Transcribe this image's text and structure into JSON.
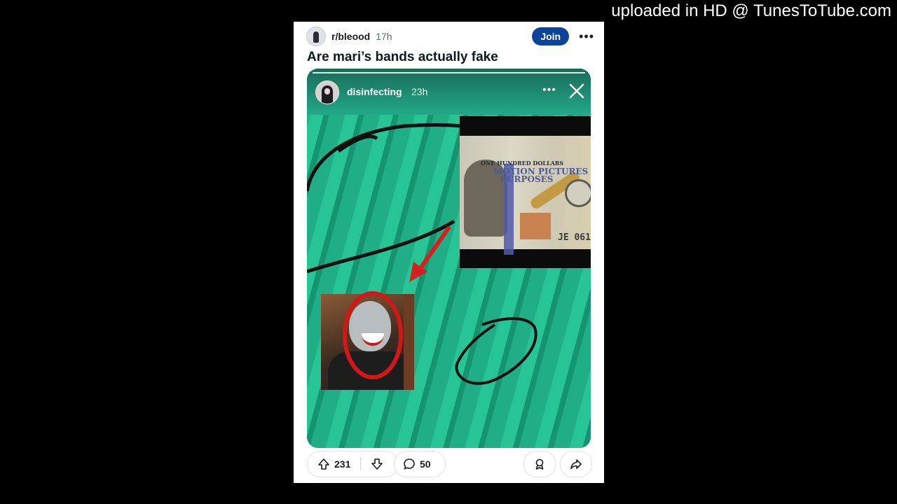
{
  "watermark": "uploaded in HD @ TunesToTube.com",
  "post": {
    "subreddit": "r/bleood",
    "age": "17h",
    "join_label": "Join",
    "more_label": "•••",
    "title": "Are mari’s bands actually fake"
  },
  "story": {
    "username": "disinfecting",
    "age": "23h",
    "more_label": "•••"
  },
  "bill": {
    "line1": "ONE HUNDRED DOLLARS",
    "line2": "MOTION PICTURES",
    "line3": "PURPOSES",
    "serial": "JE 061"
  },
  "footer": {
    "upvotes": "231",
    "comments": "50"
  },
  "colors": {
    "join_bg": "#0a449b",
    "annotation_red": "#d81f1f",
    "money_green": "#24b98f"
  }
}
